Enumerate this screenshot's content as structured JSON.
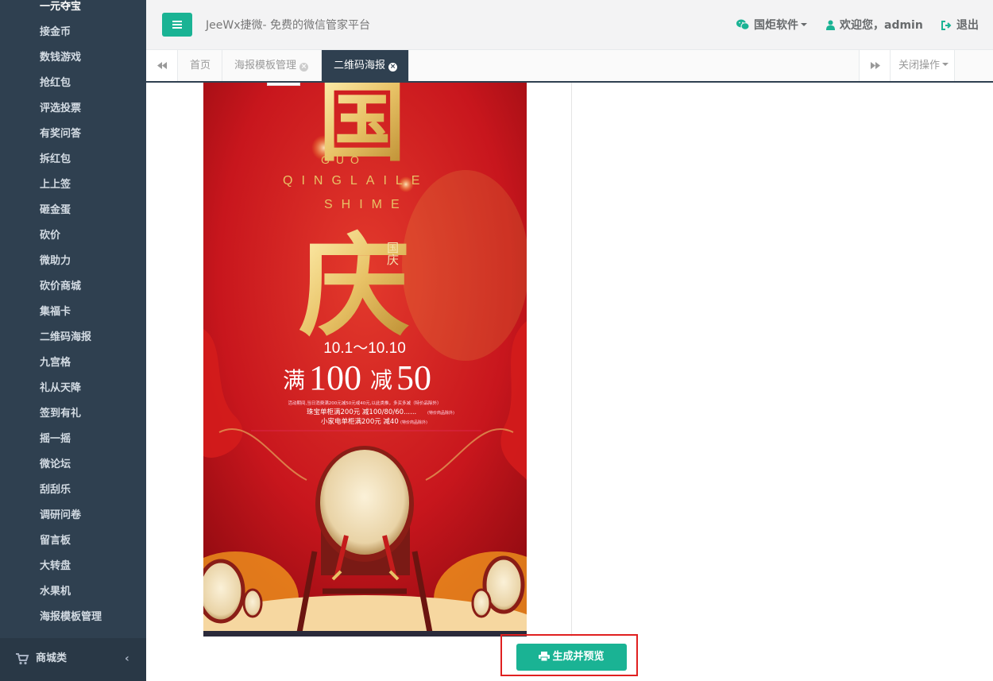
{
  "sidebar": {
    "items": [
      {
        "label": "一元夺宝"
      },
      {
        "label": "接金币"
      },
      {
        "label": "数钱游戏"
      },
      {
        "label": "抢红包"
      },
      {
        "label": "评选投票"
      },
      {
        "label": "有奖问答"
      },
      {
        "label": "拆红包"
      },
      {
        "label": "上上签"
      },
      {
        "label": "砸金蛋"
      },
      {
        "label": "砍价"
      },
      {
        "label": "微助力"
      },
      {
        "label": "砍价商城"
      },
      {
        "label": "集福卡"
      },
      {
        "label": "二维码海报"
      },
      {
        "label": "九宫格"
      },
      {
        "label": "礼从天降"
      },
      {
        "label": "签到有礼"
      },
      {
        "label": "摇一摇"
      },
      {
        "label": "微论坛"
      },
      {
        "label": "刮刮乐"
      },
      {
        "label": "调研问卷"
      },
      {
        "label": "留言板"
      },
      {
        "label": "大转盘"
      },
      {
        "label": "水果机"
      },
      {
        "label": "海报模板管理"
      }
    ],
    "category": {
      "label": "商城类",
      "icon": "cart-icon",
      "arrow": "‹"
    }
  },
  "header": {
    "title": "JeeWx捷微- 免费的微信管家平台",
    "company": "国炬软件",
    "welcome": "欢迎您，admin",
    "logout": "退出",
    "accent": "#1ab394"
  },
  "tabs": {
    "items": [
      {
        "label": "首页",
        "closable": false
      },
      {
        "label": "海报模板管理",
        "closable": true
      },
      {
        "label": "二维码海报",
        "closable": true,
        "active": true
      }
    ],
    "close_ops": "关闭操作"
  },
  "poster": {
    "title_char1": "国",
    "title_char2": "庆",
    "pinyin1": "GUO",
    "pinyin2": "QINGLAILE",
    "pinyin3": "SHIME",
    "small_label": "国庆",
    "date": "10.1～10.10",
    "promo_prefix": "满",
    "promo_num1": "100",
    "promo_mid": "减",
    "promo_num2": "50",
    "line1": "活动期间,当日消费满200元减50元或40元,以此类推，多买多减（特价品除外）",
    "line2": "珠宝单柜满200元  减100/80/60......",
    "line2_note": "(特价商品除外)",
    "line3": "小家电单柜满200元  减40",
    "line3_note": "(特价商品除外)"
  },
  "actions": {
    "generate": "生成并预览"
  }
}
